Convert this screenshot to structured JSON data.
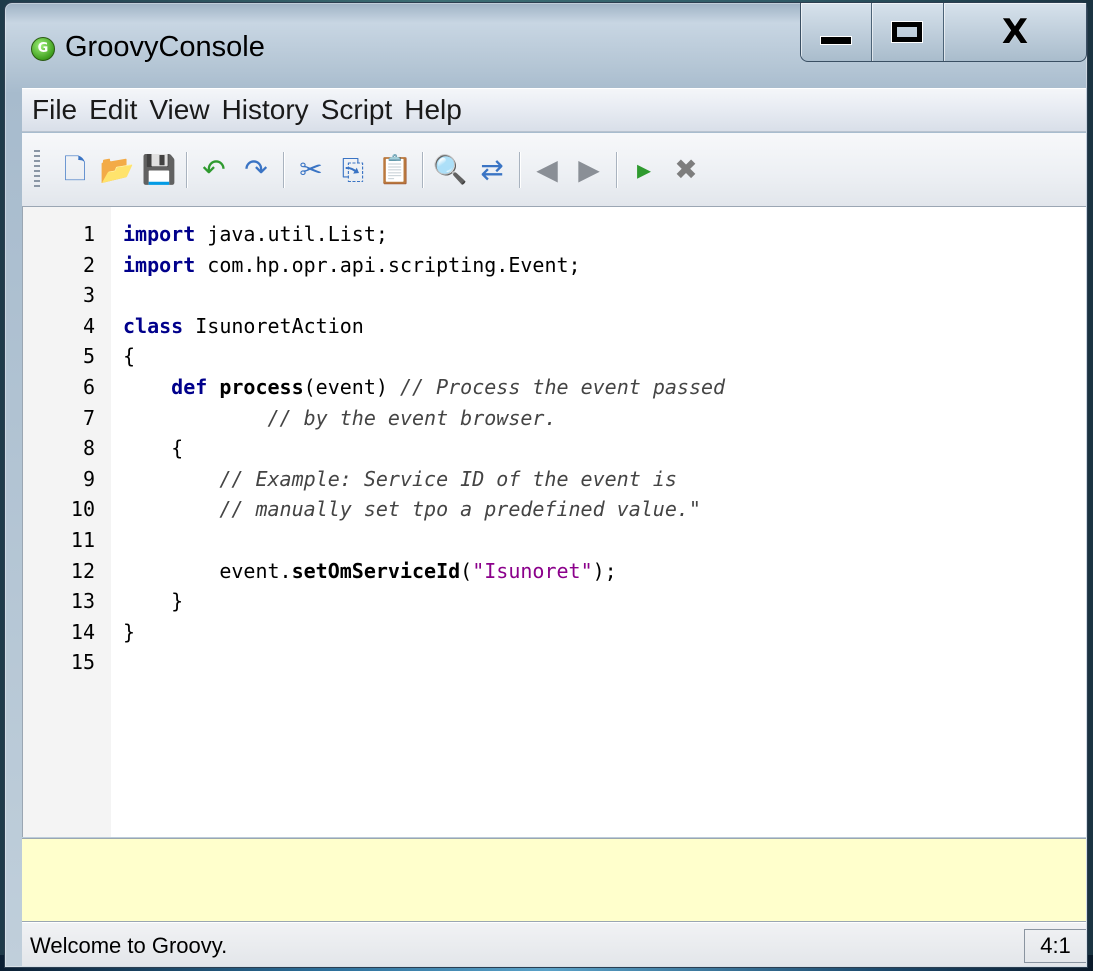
{
  "window": {
    "title": "GroovyConsole",
    "app_icon_letter": "G",
    "caption": {
      "minimize": "—",
      "maximize": "☐",
      "close": "X"
    }
  },
  "menu": [
    "File",
    "Edit",
    "View",
    "History",
    "Script",
    "Help"
  ],
  "toolbar": {
    "groups": [
      [
        {
          "name": "new-file-icon",
          "glyph": "🗋"
        },
        {
          "name": "open-file-icon",
          "glyph": "📂"
        },
        {
          "name": "save-icon",
          "glyph": "💾"
        }
      ],
      [
        {
          "name": "undo-icon",
          "glyph": "↶"
        },
        {
          "name": "redo-icon",
          "glyph": "↷"
        }
      ],
      [
        {
          "name": "cut-icon",
          "glyph": "✂"
        },
        {
          "name": "copy-icon",
          "glyph": "⎘"
        },
        {
          "name": "paste-icon",
          "glyph": "📋"
        }
      ],
      [
        {
          "name": "find-icon",
          "glyph": "🔍"
        },
        {
          "name": "replace-icon",
          "glyph": "⇄"
        }
      ],
      [
        {
          "name": "history-previous-icon",
          "glyph": "◀"
        },
        {
          "name": "history-next-icon",
          "glyph": "▶"
        }
      ],
      [
        {
          "name": "execute-script-icon",
          "glyph": "▸"
        },
        {
          "name": "interrupt-icon",
          "glyph": "✖"
        }
      ]
    ],
    "accent_colors": {
      "blue": "#3a74c4",
      "green": "#2f9a2f",
      "red": "#c03030",
      "yellow": "#e0a020"
    }
  },
  "editor": {
    "lines": [
      {
        "n": "1",
        "tokens": [
          {
            "t": "import",
            "c": "kw"
          },
          {
            "t": " java.util.List;",
            "c": ""
          }
        ]
      },
      {
        "n": "2",
        "tokens": [
          {
            "t": "import",
            "c": "kw"
          },
          {
            "t": " com.hp.opr.api.scripting.Event;",
            "c": ""
          }
        ]
      },
      {
        "n": "3",
        "tokens": []
      },
      {
        "n": "4",
        "tokens": [
          {
            "t": "class",
            "c": "kw"
          },
          {
            "t": " IsunoretAction",
            "c": ""
          }
        ]
      },
      {
        "n": "5",
        "tokens": [
          {
            "t": "{",
            "c": ""
          }
        ]
      },
      {
        "n": "6",
        "tokens": [
          {
            "t": "    ",
            "c": ""
          },
          {
            "t": "def",
            "c": "kw"
          },
          {
            "t": " ",
            "c": ""
          },
          {
            "t": "process",
            "c": "fn"
          },
          {
            "t": "(event) ",
            "c": ""
          },
          {
            "t": "// Process the event passed",
            "c": "cm"
          }
        ]
      },
      {
        "n": "7",
        "tokens": [
          {
            "t": "            ",
            "c": ""
          },
          {
            "t": "// by the event browser.",
            "c": "cm"
          }
        ]
      },
      {
        "n": "8",
        "tokens": [
          {
            "t": "    {",
            "c": ""
          }
        ]
      },
      {
        "n": "9",
        "tokens": [
          {
            "t": "        ",
            "c": ""
          },
          {
            "t": "// Example: Service ID of the event is",
            "c": "cm"
          }
        ]
      },
      {
        "n": "10",
        "tokens": [
          {
            "t": "        ",
            "c": ""
          },
          {
            "t": "// manually set tpo a predefined value.\"",
            "c": "cm"
          }
        ]
      },
      {
        "n": "11",
        "tokens": []
      },
      {
        "n": "12",
        "tokens": [
          {
            "t": "        event.",
            "c": ""
          },
          {
            "t": "setOmServiceId",
            "c": "fn"
          },
          {
            "t": "(",
            "c": ""
          },
          {
            "t": "\"Isunoret\"",
            "c": "st"
          },
          {
            "t": ");",
            "c": ""
          }
        ]
      },
      {
        "n": "13",
        "tokens": [
          {
            "t": "    }",
            "c": ""
          }
        ]
      },
      {
        "n": "14",
        "tokens": [
          {
            "t": "}",
            "c": ""
          }
        ]
      },
      {
        "n": "15",
        "tokens": []
      }
    ]
  },
  "output": "",
  "status": {
    "message": "Welcome to Groovy.",
    "caret_position": "4:1"
  }
}
